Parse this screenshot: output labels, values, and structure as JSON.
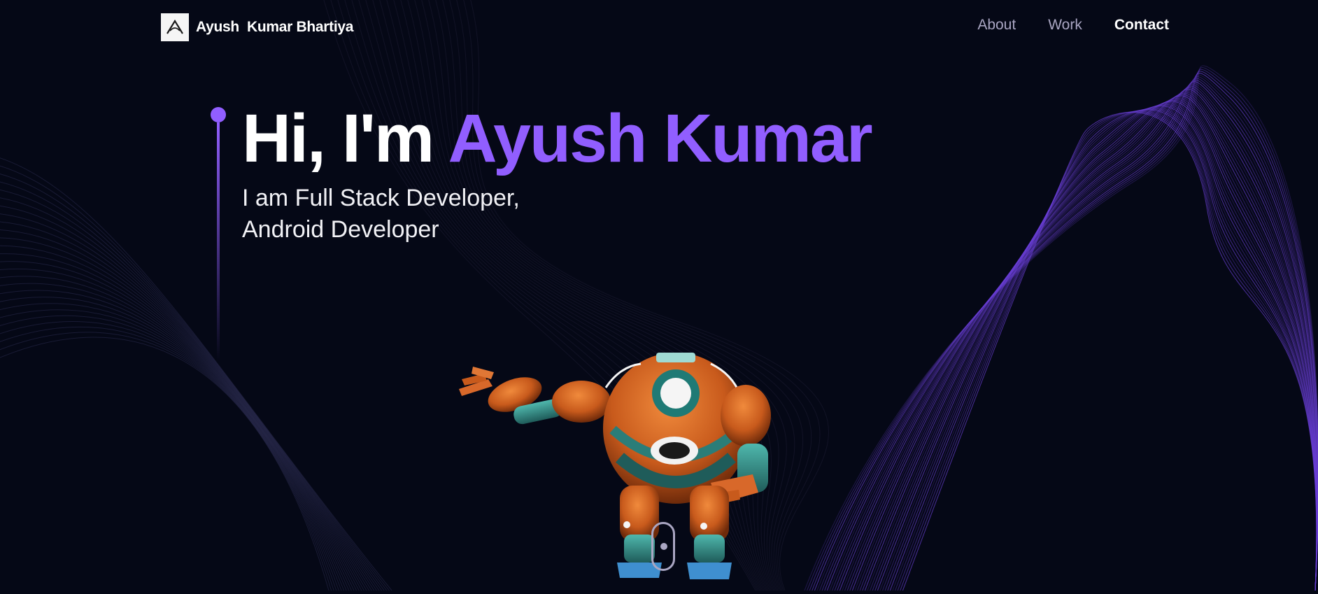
{
  "navbar": {
    "brand_name": "Ayush  Kumar Bhartiya",
    "logo_icon": "logo-a-icon",
    "links": [
      {
        "label": "About",
        "active": false
      },
      {
        "label": "Work",
        "active": false
      },
      {
        "label": "Contact",
        "active": true
      }
    ]
  },
  "hero": {
    "greeting": "Hi, I'm",
    "name": "Ayush Kumar",
    "subtitle_line1": "I am Full Stack Developer,",
    "subtitle_line2": "Android Developer"
  },
  "media": {
    "robot": "3d-robot-model",
    "scroll_indicator": "mouse-scroll-icon"
  },
  "theme": {
    "background": "#050816",
    "accent": "#915eff",
    "secondary_text": "#aaa6c3",
    "white": "#ffffff"
  }
}
